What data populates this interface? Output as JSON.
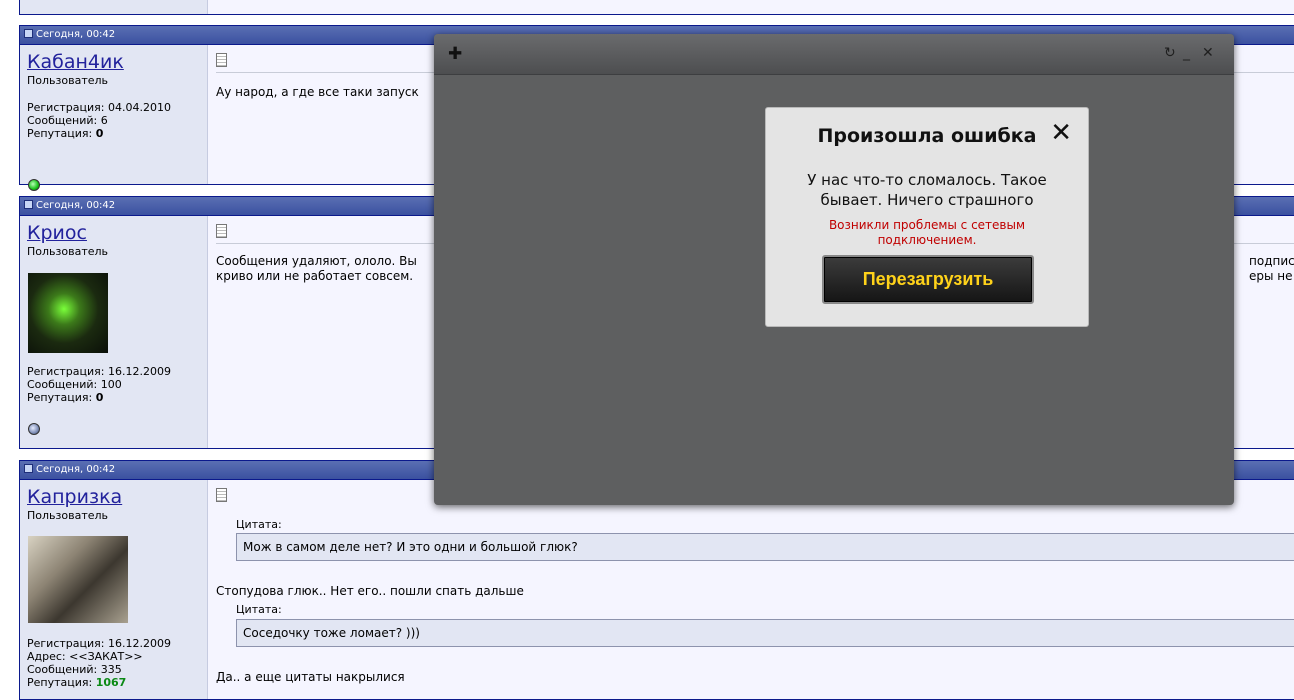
{
  "posts": [
    {
      "date": "Сегодня, 00:42",
      "username": "Кабан4ик",
      "role": "Пользователь",
      "reg_label": "Регистрация:",
      "reg_date": "04.04.2010",
      "msgs_label": "Сообщений:",
      "msgs": "6",
      "rep_label": "Репутация:",
      "rep": "0",
      "status": "online",
      "lines": [
        "Ау народ, а где все таки запуск"
      ]
    },
    {
      "date": "Сегодня, 00:42",
      "username": "Криос",
      "role": "Пользователь",
      "reg_label": "Регистрация:",
      "reg_date": "16.12.2009",
      "msgs_label": "Сообщений:",
      "msgs": "100",
      "rep_label": "Репутация:",
      "rep": "0",
      "status": "offline",
      "lines": [
        "Сообщения удаляют, ололо. Вы",
        "криво или не работает совсем."
      ],
      "right_fragments": [
        "подписка",
        "еры не за"
      ]
    },
    {
      "date": "Сегодня, 00:42",
      "username": "Капризка",
      "role": "Пользователь",
      "reg_label": "Регистрация:",
      "reg_date": "16.12.2009",
      "addr_label": "Адрес:",
      "addr": "<<ЗАКАТ>>",
      "msgs_label": "Сообщений:",
      "msgs": "335",
      "rep_label": "Репутация:",
      "rep": "1067",
      "quote_label": "Цитата:",
      "quote1": "Мож в самом деле нет? И это одни и большой глюк?",
      "text1": "Стопудова глюк.. Нет его.. пошли спать дальше",
      "quote2": "Соседочку тоже ломает? )))",
      "text2": "Да.. а еще цитаты накрылися"
    }
  ],
  "overlay": {
    "controls": [
      "↻",
      "_",
      "✕"
    ],
    "dialog": {
      "title": "Произошла ошибка",
      "close": "✕",
      "message": "У нас что-то сломалось. Такое бывает. Ничего страшного",
      "error": "Возникли проблемы с сетевым подключением.",
      "button": "Перезагрузить"
    }
  },
  "colors": {
    "header": "#3b51a0",
    "button_text": "#ffd21a",
    "error": "#c00000"
  }
}
